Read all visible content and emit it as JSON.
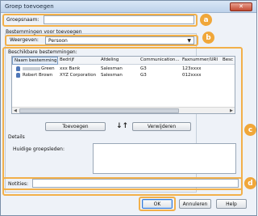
{
  "window": {
    "title": "Groep toevoegen",
    "close_label": "✕"
  },
  "form": {
    "group_name_label": "Groepsnaam:",
    "group_name_value": "",
    "destination_label": "Bestemmingen voor toevoegen",
    "view_label": "Weergeven:",
    "view_value": "Persoon",
    "available_label": "Beschikbare bestemmingen:",
    "details_label": "Details",
    "current_members_label": "Huidige groepsleden:",
    "notes_label": "Notities:",
    "notes_value": ""
  },
  "table": {
    "columns": [
      "Naam bestemming",
      "Bedrijf",
      "Afdeling",
      "Communication...",
      "Faxnummer/URI",
      "Besc"
    ],
    "rows": [
      {
        "name": "Green",
        "company": "xxx Bank",
        "department": "Salesman",
        "communication": "G3",
        "fax": "123xxxx"
      },
      {
        "name": "Robert Brown",
        "company": "XYZ Corporation",
        "department": "Salesman",
        "communication": "G3",
        "fax": "012xxxx"
      }
    ]
  },
  "buttons": {
    "add": "Toevoegen",
    "remove": "Verwijderen",
    "swap": "↓↑",
    "ok": "OK",
    "cancel": "Annuleren",
    "help": "Help"
  },
  "callouts": {
    "a": "a",
    "b": "b",
    "c": "c",
    "d": "d"
  },
  "icons": {
    "user": "user-icon",
    "close": "close-icon",
    "dropdown": "chevron-down-icon"
  },
  "colors": {
    "highlight": "#f2b04a",
    "callout": "#f0a73a",
    "titlebar": "#bdd2ea",
    "close": "#c24a32"
  }
}
